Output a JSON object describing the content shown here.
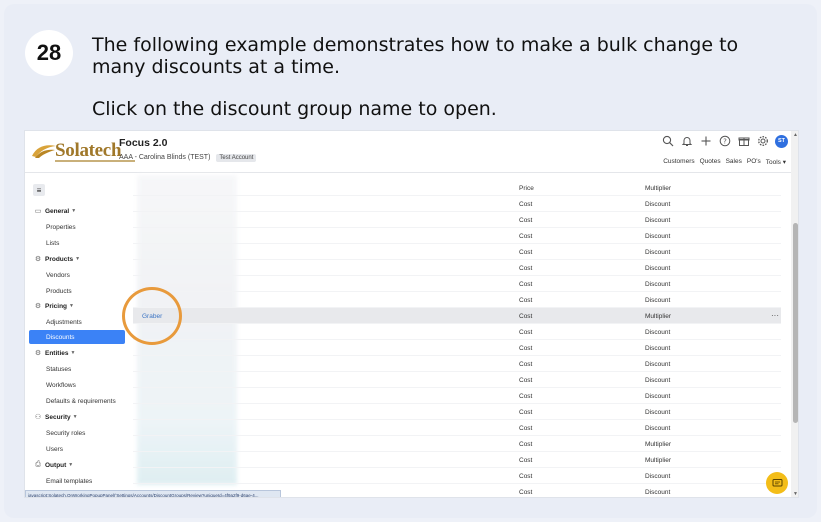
{
  "step": {
    "number": "28",
    "instruction_1": "The following example demonstrates how to make a bulk change to many discounts at a time.",
    "instruction_2": "Click on the discount group name to open."
  },
  "app": {
    "brand": "Solatech",
    "title": "Focus 2.0",
    "account": "AAA - Carolina Blinds (TEST)",
    "account_badge": "Test Account",
    "user_initials": "ST",
    "top_nav": [
      "Customers",
      "Quotes",
      "Sales",
      "PO's",
      "Tools ▾"
    ]
  },
  "icons": {
    "header": [
      "search-icon",
      "bell-icon",
      "plus-icon",
      "help-icon",
      "gift-icon",
      "gear-icon"
    ],
    "menu": "hamburger-icon",
    "chat": "chat-icon"
  },
  "sidebar": {
    "groups": [
      {
        "label": "General",
        "icon": "monitor-icon",
        "items": [
          "Properties",
          "Lists"
        ]
      },
      {
        "label": "Products",
        "icon": "gear-icon",
        "items": [
          "Vendors",
          "Products"
        ]
      },
      {
        "label": "Pricing",
        "icon": "gear-icon",
        "items": [
          "Adjustments",
          "Discounts"
        ]
      },
      {
        "label": "Entities",
        "icon": "gear-icon",
        "items": [
          "Statuses",
          "Workflows",
          "Defaults & requirements"
        ]
      },
      {
        "label": "Security",
        "icon": "users-icon",
        "items": [
          "Security roles",
          "Users"
        ]
      },
      {
        "label": "Output",
        "icon": "printer-icon",
        "items": [
          "Email templates"
        ]
      }
    ],
    "active": "Discounts"
  },
  "table": {
    "rows": [
      {
        "name": "",
        "type": "Price",
        "mode": "Multiplier"
      },
      {
        "name": "",
        "type": "Cost",
        "mode": "Discount"
      },
      {
        "name": "",
        "type": "Cost",
        "mode": "Discount"
      },
      {
        "name": "",
        "type": "Cost",
        "mode": "Discount"
      },
      {
        "name": "",
        "type": "Cost",
        "mode": "Discount"
      },
      {
        "name": "",
        "type": "Cost",
        "mode": "Discount"
      },
      {
        "name": "",
        "type": "Cost",
        "mode": "Discount"
      },
      {
        "name": "",
        "type": "Cost",
        "mode": "Discount"
      },
      {
        "name": "Graber",
        "type": "Cost",
        "mode": "Multiplier",
        "highlighted": true,
        "more": "···"
      },
      {
        "name": "",
        "type": "Cost",
        "mode": "Discount"
      },
      {
        "name": "",
        "type": "Cost",
        "mode": "Discount"
      },
      {
        "name": "",
        "type": "Cost",
        "mode": "Discount"
      },
      {
        "name": "",
        "type": "Cost",
        "mode": "Discount"
      },
      {
        "name": "",
        "type": "Cost",
        "mode": "Discount"
      },
      {
        "name": "",
        "type": "Cost",
        "mode": "Discount"
      },
      {
        "name": "",
        "type": "Cost",
        "mode": "Discount"
      },
      {
        "name": "",
        "type": "Cost",
        "mode": "Multiplier"
      },
      {
        "name": "",
        "type": "Cost",
        "mode": "Multiplier"
      },
      {
        "name": "",
        "type": "Cost",
        "mode": "Discount"
      },
      {
        "name": "",
        "type": "Cost",
        "mode": "Discount"
      }
    ]
  },
  "status_url": "javascript:Solatech.OnWorkingPopupPanel('Settings/Accounts/DiscountGroups/Review?uniqueId=4f9a2f9-d6ae-4...",
  "colors": {
    "accent": "#3b82f6",
    "highlight": "#e89a3c",
    "chat": "#f3bd18"
  }
}
